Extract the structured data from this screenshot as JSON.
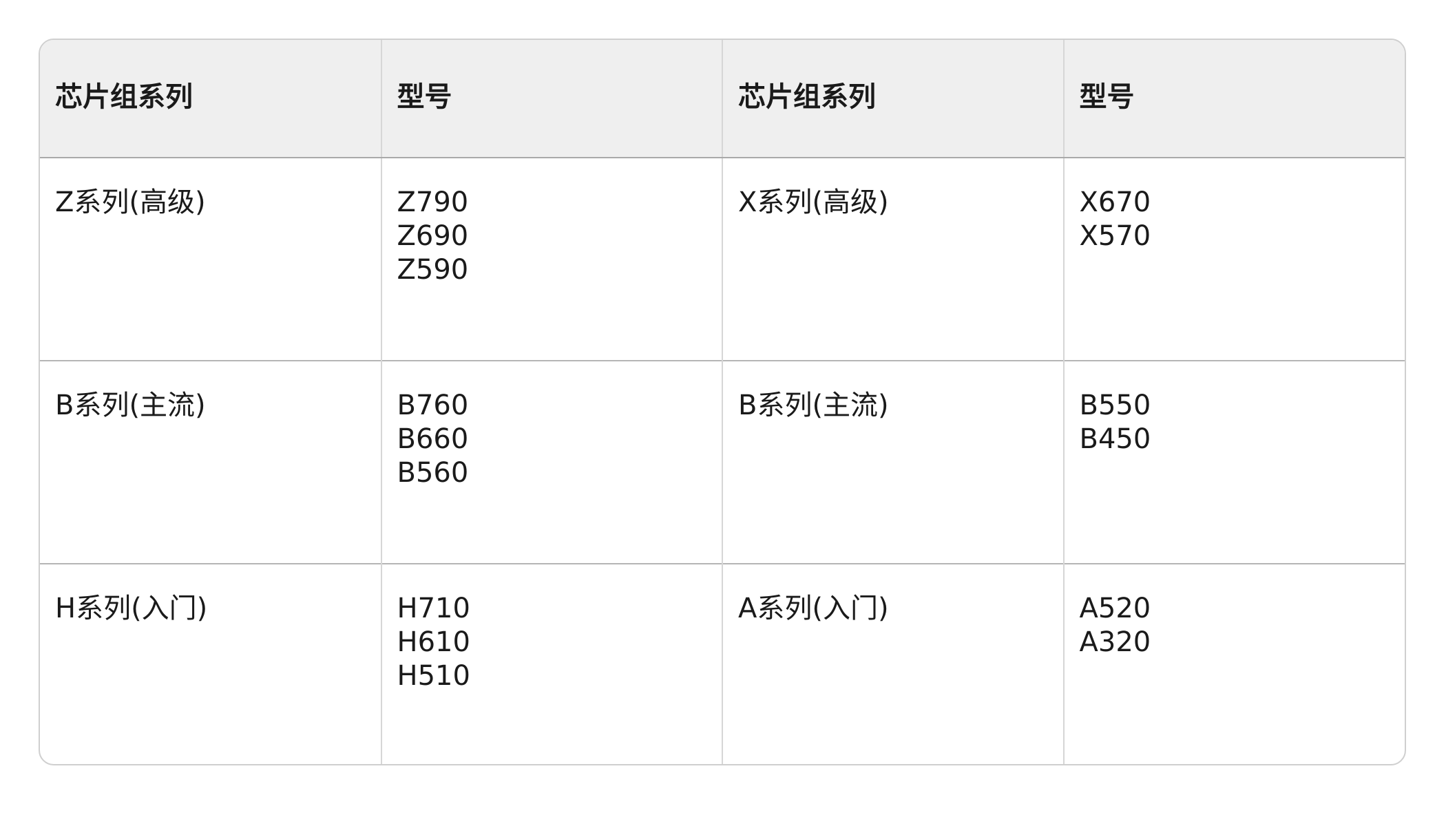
{
  "table": {
    "headers": [
      "芯片组系列",
      "型号",
      "芯片组系列",
      "型号"
    ],
    "rows": [
      {
        "intel_series": "Z系列(高级)",
        "intel_models": [
          "Z790",
          "Z690",
          "Z590"
        ],
        "amd_series": "X系列(高级)",
        "amd_models": [
          "X670",
          "X570"
        ]
      },
      {
        "intel_series": "B系列(主流)",
        "intel_models": [
          "B760",
          "B660",
          "B560"
        ],
        "amd_series": "B系列(主流)",
        "amd_models": [
          "B550",
          "B450"
        ]
      },
      {
        "intel_series": "H系列(入门)",
        "intel_models": [
          "H710",
          "H610",
          "H510"
        ],
        "amd_series": "A系列(入门)",
        "amd_models": [
          "A520",
          "A320"
        ]
      }
    ]
  }
}
